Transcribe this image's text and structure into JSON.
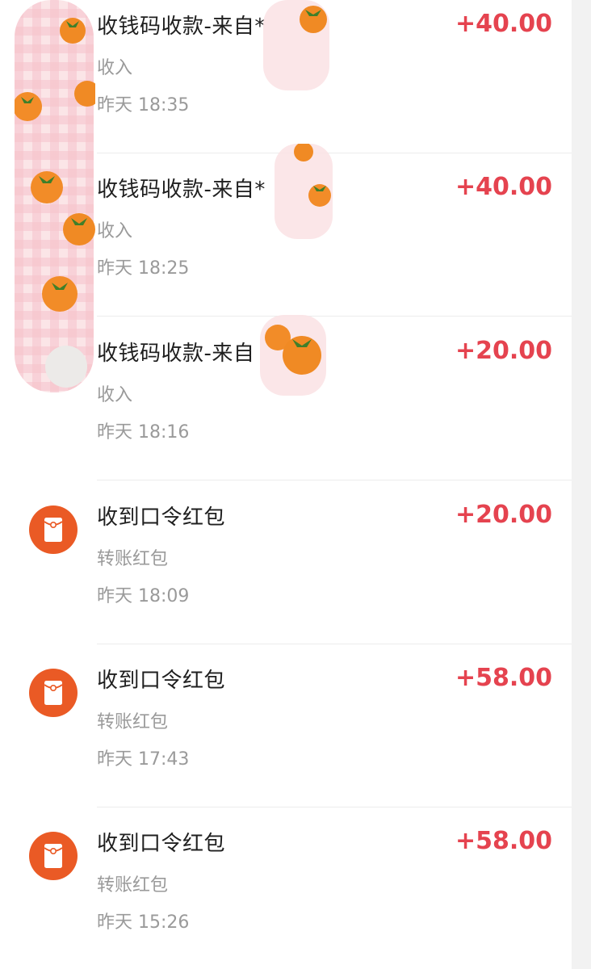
{
  "transactions": [
    {
      "title": "收钱码收款-来自*",
      "category": "收入",
      "time": "昨天 18:35",
      "amount": "+40.00",
      "icon": "user-avatar"
    },
    {
      "title": "收钱码收款-来自*",
      "category": "收入",
      "time": "昨天 18:25",
      "amount": "+40.00",
      "icon": "user-avatar"
    },
    {
      "title": "收钱码收款-来自",
      "category": "收入",
      "time": "昨天 18:16",
      "amount": "+20.00",
      "icon": "user-avatar"
    },
    {
      "title": "收到口令红包",
      "category": "转账红包",
      "time": "昨天 18:09",
      "amount": "+20.00",
      "icon": "red-envelope-icon"
    },
    {
      "title": "收到口令红包",
      "category": "转账红包",
      "time": "昨天 17:43",
      "amount": "+58.00",
      "icon": "red-envelope-icon"
    },
    {
      "title": "收到口令红包",
      "category": "转账红包",
      "time": "昨天 15:26",
      "amount": "+58.00",
      "icon": "red-envelope-icon"
    }
  ],
  "colors": {
    "amount": "#e5434f",
    "envelope": "#ea5a25",
    "title": "#1f1f1f",
    "secondary": "#9a9a9a"
  }
}
